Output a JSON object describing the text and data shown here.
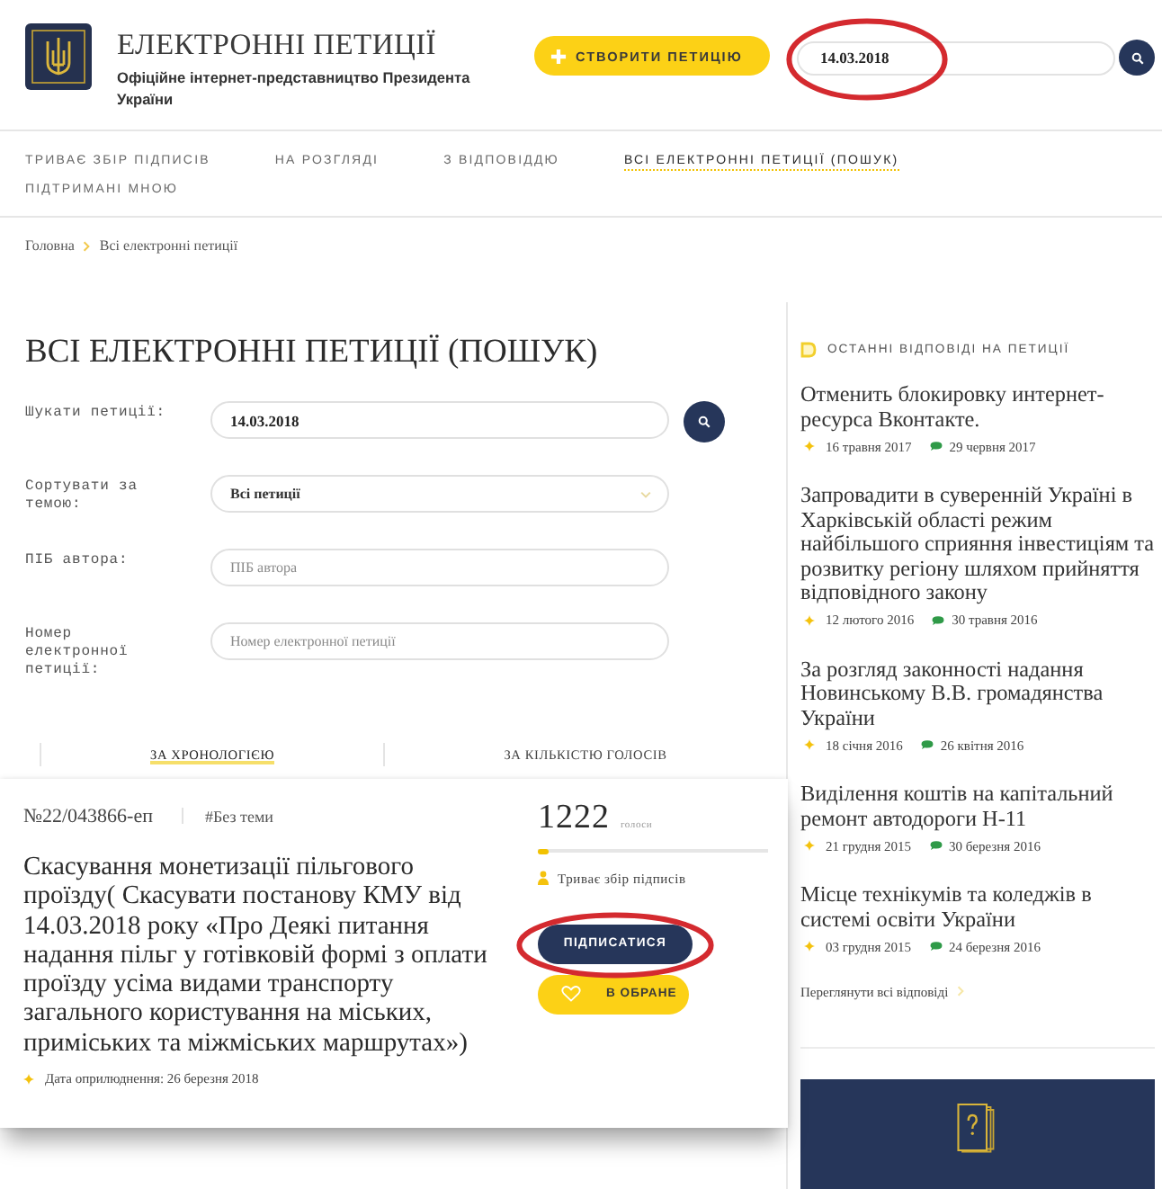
{
  "header": {
    "title": "ЕЛЕКТРОННІ ПЕТИЦІЇ",
    "subtitle": "Офіційне інтернет-представництво Президента України",
    "create_button": "СТВОРИТИ ПЕТИЦІЮ",
    "search": {
      "value": "14.03.2018",
      "circled": true
    }
  },
  "nav": [
    {
      "label": "ТРИВАЄ ЗБІР ПІДПИСІВ",
      "selected": false
    },
    {
      "label": "НА РОЗГЛЯДІ",
      "selected": false
    },
    {
      "label": "З ВІДПОВІДДЮ",
      "selected": false
    },
    {
      "label": "ВСІ ЕЛЕКТРОННІ ПЕТИЦІЇ (ПОШУК)",
      "selected": true
    },
    {
      "label": "ПІДТРИМАНІ МНОЮ",
      "selected": false
    }
  ],
  "breadcrumb": [
    "Головна",
    "Всі електронні петиції"
  ],
  "page_title": "ВСІ ЕЛЕКТРОННІ ПЕТИЦІЇ (ПОШУК)",
  "form": {
    "fields": [
      {
        "kind": "search",
        "label": "Шукати петиції:",
        "value": "14.03.2018"
      },
      {
        "kind": "select",
        "label": "Сортувати за темою:",
        "value": "Всі петиції"
      },
      {
        "kind": "text",
        "label": "ПІБ автора:",
        "placeholder": "ПІБ автора"
      },
      {
        "kind": "text",
        "label": "Номер електронної петиції:",
        "placeholder": "Номер електронної петиції"
      }
    ]
  },
  "sort_tabs": [
    {
      "label": "ЗА ХРОНОЛОГІЄЮ",
      "selected": true
    },
    {
      "label": "ЗА КІЛЬКІСТЮ ГОЛОСІВ",
      "selected": false
    }
  ],
  "petition": {
    "number": "№22/043866-еп",
    "topic": "#Без теми",
    "title": "Скасування монетизації пільгового проїзду( Скасувати постанову КМУ від 14.03.2018 року «Про Деякі питання надання пільг у готівковій формі з оплати проїзду усіма видами транспорту загального користування на міських, приміських та міжміських маршрутах»)",
    "published": "Дата оприлюднення: 26 березня 2018",
    "votes": "1222",
    "votes_unit": "голоси",
    "level": 0.05,
    "status": "Триває збір підписів",
    "sign_button": {
      "label": "ПІДПИСАТИСЯ",
      "circled": true
    },
    "favorite_button": "В ОБРАНЕ"
  },
  "sidebar": {
    "heading": "ОСТАННІ ВІДПОВІДІ НА ПЕТИЦІЇ",
    "items": [
      {
        "title": "Отменить блокировку интернет-ресурса Вконтакте.",
        "published": "16 травня 2017",
        "answered": "29 червня 2017"
      },
      {
        "title": "Запровадити в суверенній Україні в Харківській області режим найбільшого сприяння інвестиціям та розвитку регіону шляхом прийняття відповідного закону",
        "published": "12 лютого 2016",
        "answered": "30 травня 2016"
      },
      {
        "title": "За розгляд законності надання Новинському В.В. громадянства України",
        "published": "18 січня 2016",
        "answered": "26 квітня 2016"
      },
      {
        "title": "Виділення коштів на капітальний ремонт автодороги Н-11",
        "published": "21 грудня 2015",
        "answered": "30 березня 2016"
      },
      {
        "title": "Місце технікумів та коледжів в системі освіти України",
        "published": "03 грудня 2015",
        "answered": "24 березня 2016"
      }
    ],
    "all_link": "Переглянути всі відповіді"
  }
}
